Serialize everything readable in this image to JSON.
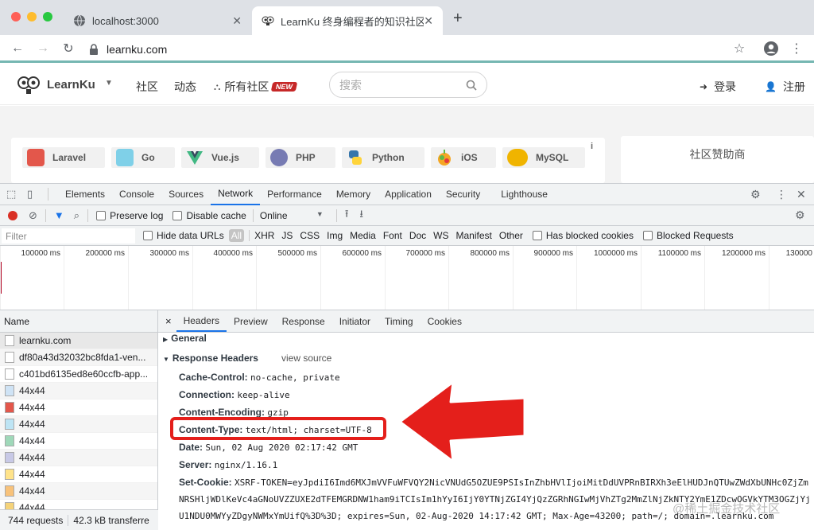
{
  "browser": {
    "tabs": [
      {
        "title": "localhost:3000",
        "active": false
      },
      {
        "title": "LearnKu 终身编程者的知识社区",
        "active": true
      }
    ],
    "new_tab": "+",
    "url": "learnku.com"
  },
  "site": {
    "brand": "LearnKu",
    "nav": [
      "社区",
      "动态",
      "所有社区"
    ],
    "new_badge": "NEW",
    "search_placeholder": "搜索",
    "login": "登录",
    "register": "注册",
    "categories": [
      {
        "name": "Laravel",
        "color": "#e3574b"
      },
      {
        "name": "Go",
        "color": "#7fd0e8"
      },
      {
        "name": "Vue.js",
        "color": "#41b883"
      },
      {
        "name": "PHP",
        "color": "#777bb3"
      },
      {
        "name": "Python",
        "color": "#3776ab"
      },
      {
        "name": "iOS",
        "color": "#f5a623"
      },
      {
        "name": "MySQL",
        "color": "#f0b400"
      }
    ],
    "info_mark": "i",
    "sponsor_title": "社区赞助商"
  },
  "devtools": {
    "panels": [
      "Elements",
      "Console",
      "Sources",
      "Network",
      "Performance",
      "Memory",
      "Application",
      "Security",
      "Lighthouse"
    ],
    "active_panel": "Network",
    "toolbar": {
      "preserve_log": "Preserve log",
      "disable_cache": "Disable cache",
      "throttling": "Online"
    },
    "filter": {
      "placeholder": "Filter",
      "hide_data_urls": "Hide data URLs",
      "types": [
        "All",
        "XHR",
        "JS",
        "CSS",
        "Img",
        "Media",
        "Font",
        "Doc",
        "WS",
        "Manifest",
        "Other"
      ],
      "has_blocked_cookies": "Has blocked cookies",
      "blocked_requests": "Blocked Requests"
    },
    "timeline_ticks": [
      "100000 ms",
      "200000 ms",
      "300000 ms",
      "400000 ms",
      "500000 ms",
      "600000 ms",
      "700000 ms",
      "800000 ms",
      "900000 ms",
      "1000000 ms",
      "1100000 ms",
      "1200000 ms",
      "130000"
    ],
    "name_header": "Name",
    "requests": [
      "learnku.com",
      "df80a43d32032bc8fda1-ven...",
      "c401bd6135ed8e60ccfb-app...",
      "44x44",
      "44x44",
      "44x44",
      "44x44",
      "44x44",
      "44x44",
      "44x44",
      "44x44"
    ],
    "status": {
      "requests": "744 requests",
      "transferred": "42.3 kB transferre"
    },
    "detail_tabs": [
      "Headers",
      "Preview",
      "Response",
      "Initiator",
      "Timing",
      "Cookies"
    ],
    "active_detail_tab": "Headers",
    "close_detail": "×",
    "general": "General",
    "response_headers": "Response Headers",
    "view_source": "view source",
    "headers": [
      {
        "key": "Cache-Control:",
        "value": "no-cache, private"
      },
      {
        "key": "Connection:",
        "value": "keep-alive"
      },
      {
        "key": "Content-Encoding:",
        "value": "gzip"
      },
      {
        "key": "Content-Type:",
        "value": "text/html; charset=UTF-8"
      },
      {
        "key": "Date:",
        "value": "Sun, 02 Aug 2020 02:17:42 GMT"
      },
      {
        "key": "Server:",
        "value": "nginx/1.16.1"
      },
      {
        "key": "Set-Cookie:",
        "value": "XSRF-TOKEN=eyJpdiI6Imd6MXJmVVFuWFVQY2NicVNUdG5OZUE9PSIsInZhbHVlIjoiMitDdUVPRnBIRXh3eElHUDJnQTUwZWdXbUNHc0ZjZm"
      }
    ],
    "cookie_lines": [
      "NRSHljWDlKeVc4aGNoUVZZUXE2dTFEMGRDNW1ham9iTCIsIm1hYyI6IjY0YTNjZGI4YjQzZGRhNGIwMjVhZTg2MmZlNjZkNTY2YmE1ZDcwOGVkYTM3OGZjYj",
      "U1NDU0MWYyZDgyNWMxYmUifQ%3D%3D; expires=Sun, 02-Aug-2020 14:17:42 GMT; Max-Age=43200; path=/; domain=.learnku.com"
    ],
    "watermark": "@稀土掘金技术社区"
  }
}
